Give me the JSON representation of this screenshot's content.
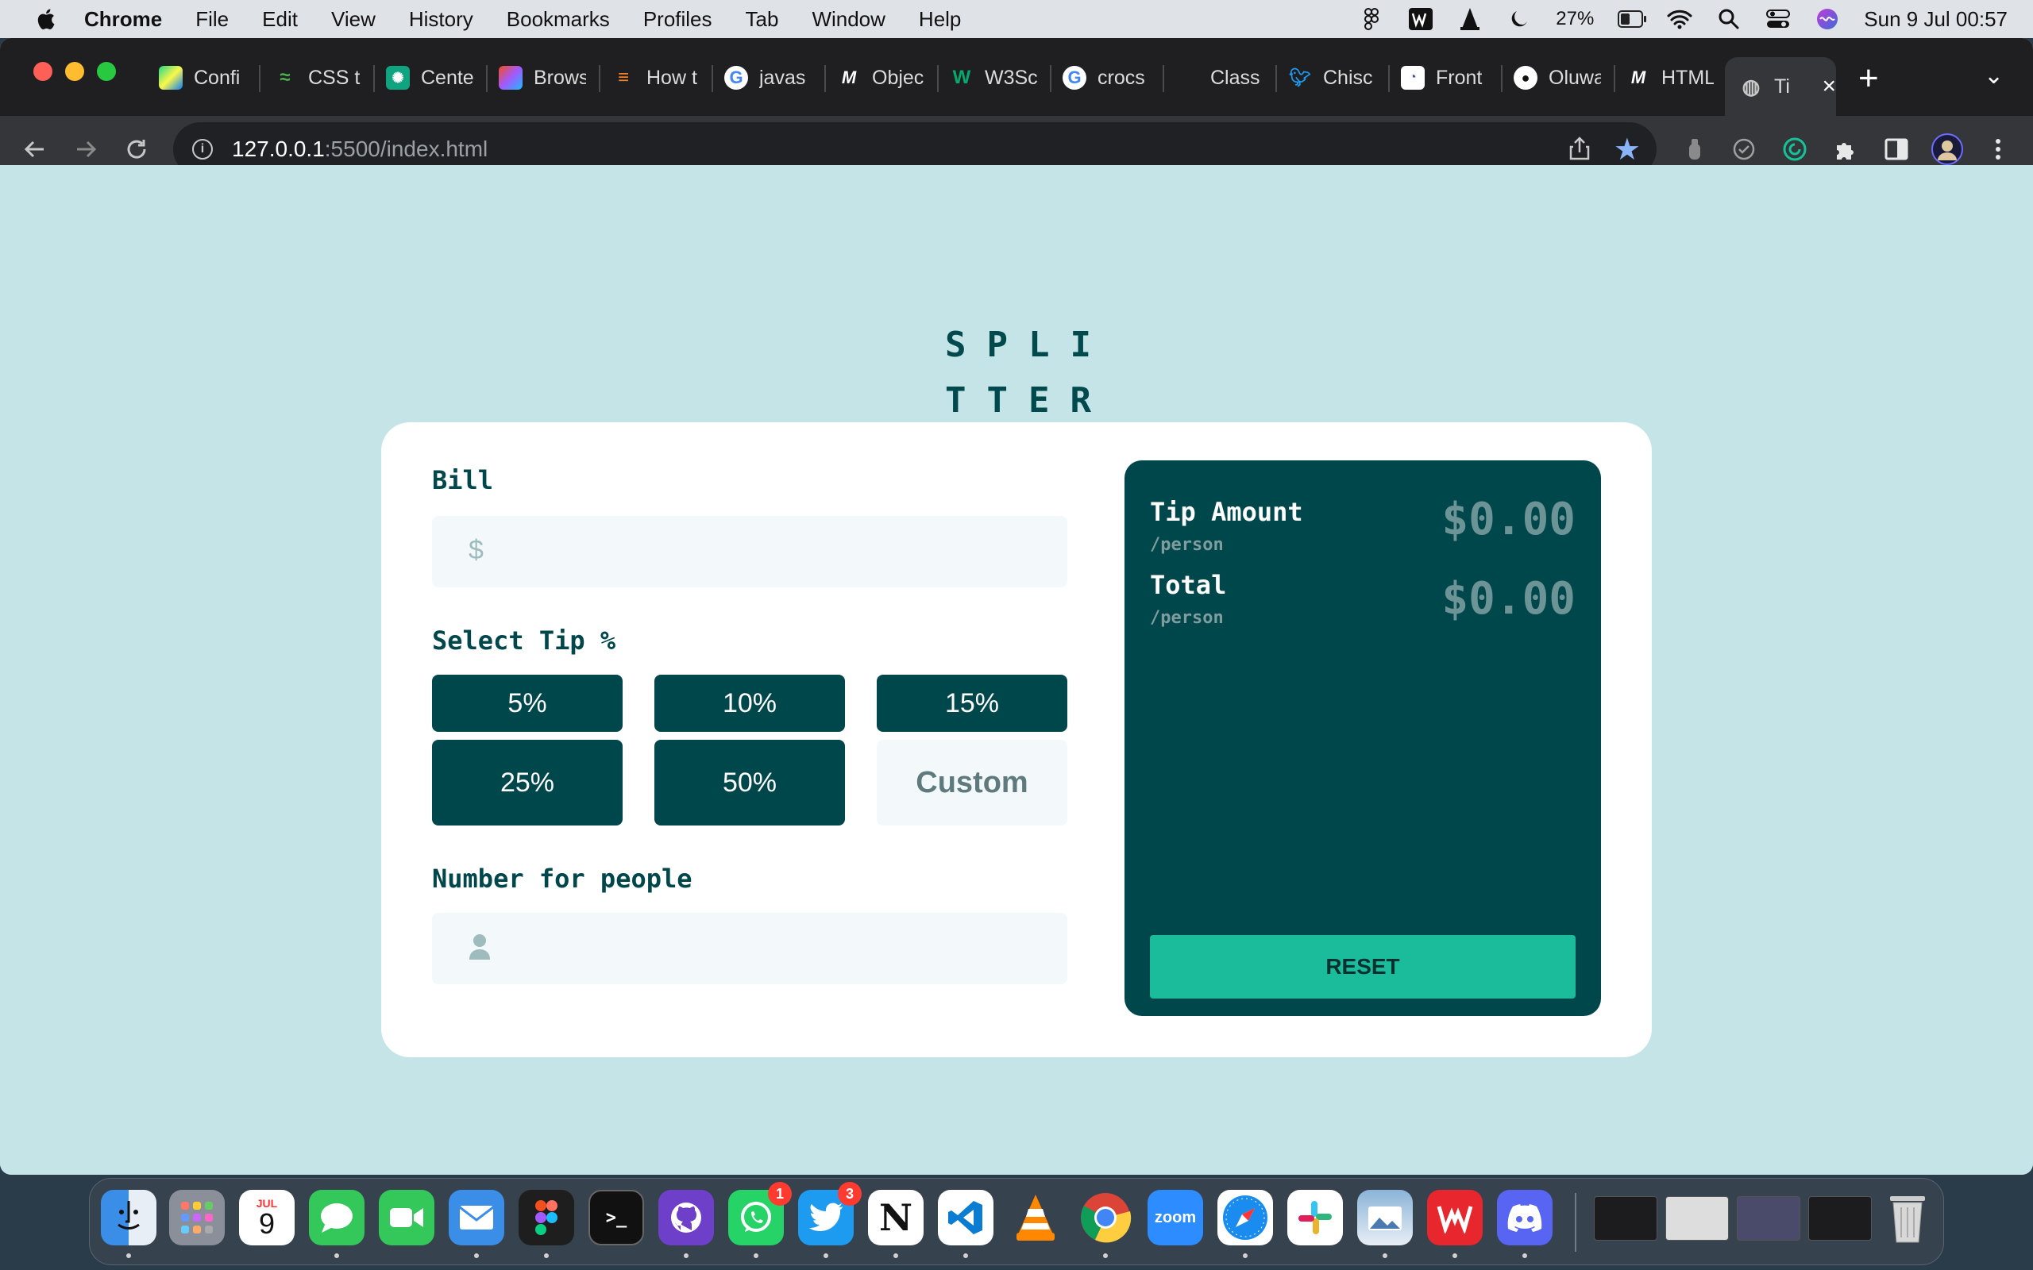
{
  "menubar": {
    "app_name": "Chrome",
    "items": [
      "File",
      "Edit",
      "View",
      "History",
      "Bookmarks",
      "Profiles",
      "Tab",
      "Window",
      "Help"
    ],
    "battery_percent": "27%",
    "battery_level": 0.27,
    "clock": "Sun 9 Jul  00:57"
  },
  "browser": {
    "tabs": [
      {
        "label": "Confi",
        "icon": "pycharm-icon"
      },
      {
        "label": "CSS t",
        "icon": "css-tricks-icon"
      },
      {
        "label": "Cente",
        "icon": "chatgpt-icon"
      },
      {
        "label": "Brows",
        "icon": "figma-icon"
      },
      {
        "label": "How t",
        "icon": "stackoverflow-icon"
      },
      {
        "label": "javas",
        "icon": "google-icon"
      },
      {
        "label": "Objec",
        "icon": "mdn-icon"
      },
      {
        "label": "W3Sc",
        "icon": "w3schools-icon"
      },
      {
        "label": "crocs",
        "icon": "google-icon"
      },
      {
        "label": "Class",
        "icon": "blank-icon"
      },
      {
        "label": "Chisc",
        "icon": "twitter-icon"
      },
      {
        "label": "Front",
        "icon": "frontendmentor-icon"
      },
      {
        "label": "Oluwa",
        "icon": "github-icon"
      },
      {
        "label": "HTML",
        "icon": "mdn-icon"
      }
    ],
    "active_tab": {
      "label": "Ti",
      "icon": "globe-icon"
    },
    "url_host": "127.0.0.1",
    "url_path": ":5500/index.html"
  },
  "app": {
    "logo_line1": "SPLI",
    "logo_line2": "TTER",
    "bill_label": "Bill",
    "bill_icon": "$",
    "bill_value": "",
    "tip_label": "Select Tip %",
    "tips": [
      "5%",
      "10%",
      "15%",
      "25%",
      "50%"
    ],
    "custom_placeholder": "Custom",
    "people_label": "Number for people",
    "people_value": "",
    "tip_amount_label": "Tip Amount",
    "tip_amount_sub": "/person",
    "tip_amount_value": "$0.00",
    "total_label": "Total",
    "total_sub": "/person",
    "total_value": "$0.00",
    "reset_label": "RESET",
    "colors": {
      "accent": "#00474b",
      "reset": "#1abc9c",
      "background": "#c5e4e7"
    }
  },
  "dock": {
    "calendar_month": "JUL",
    "calendar_day": "9",
    "whatsapp_badge": "1",
    "twitter_badge": "3",
    "zoom_label": "zoom",
    "terminal_label": ">_"
  }
}
